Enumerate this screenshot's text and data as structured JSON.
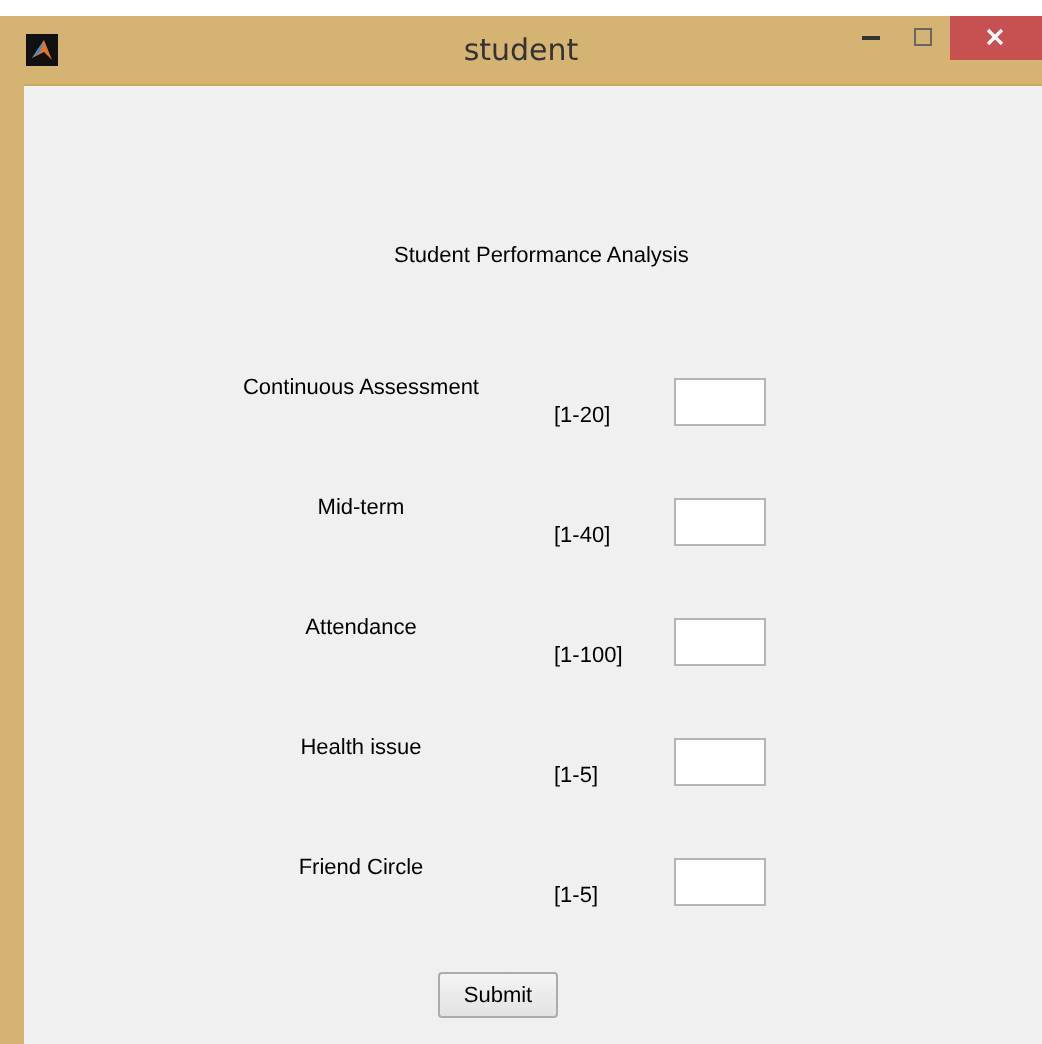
{
  "window": {
    "title": "student"
  },
  "heading": "Student Performance Analysis",
  "fields": [
    {
      "label": "Continuous Assessment",
      "range": "[1-20]"
    },
    {
      "label": "Mid-term",
      "range": "[1-40]"
    },
    {
      "label": "Attendance",
      "range": "[1-100]"
    },
    {
      "label": "Health issue",
      "range": "[1-5]"
    },
    {
      "label": "Friend Circle",
      "range": "[1-5]"
    }
  ],
  "submit_button": "Submit"
}
